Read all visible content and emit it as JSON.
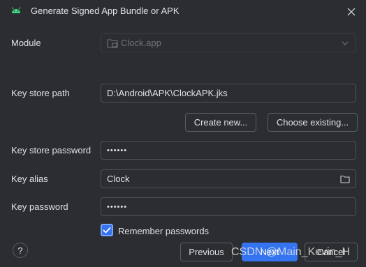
{
  "window": {
    "title": "Generate Signed App Bundle or APK"
  },
  "module": {
    "label": "Module",
    "value": "Clock.app"
  },
  "key_store_path": {
    "label": "Key store path",
    "value": "D:\\Android\\APK\\ClockAPK.jks"
  },
  "buttons": {
    "create_new": "Create new...",
    "choose_existing": "Choose existing...",
    "previous": "Previous",
    "next": "Next",
    "cancel": "Cancel",
    "help": "?"
  },
  "key_store_password": {
    "label": "Key store password",
    "value": "••••••"
  },
  "key_alias": {
    "label": "Key alias",
    "value": "Clock"
  },
  "key_password": {
    "label": "Key password",
    "value": "••••••"
  },
  "remember": {
    "label": "Remember passwords",
    "checked": true
  },
  "watermark": "CSDN @Main_Kevin_H",
  "colors": {
    "accent": "#3574f0",
    "background": "#2b2d30",
    "android": "#3ddc84"
  },
  "icons": [
    "android-icon",
    "close-icon",
    "module-icon",
    "chevron-down-icon",
    "folder-icon",
    "check-icon"
  ]
}
